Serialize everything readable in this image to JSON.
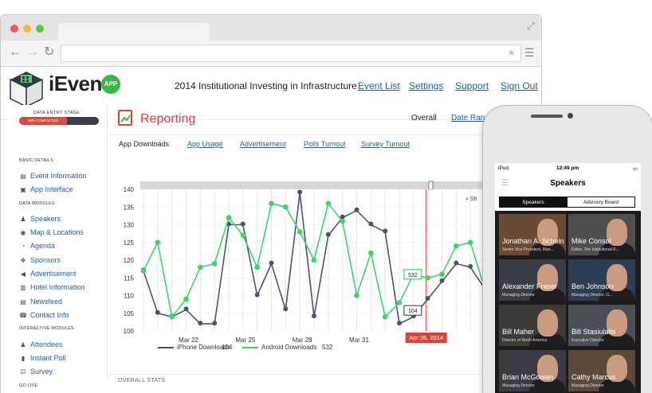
{
  "app": {
    "name": "iEvent",
    "badge": "APP"
  },
  "header": {
    "event_title": "2014 Institutional Investing in Infrastructure",
    "links": [
      "Event List",
      "Settings",
      "Support",
      "Sign Out"
    ]
  },
  "sidebar": {
    "stage_label": "DATA ENTRY STAGE",
    "stage_progress_text": "10% COMPLETED",
    "stage_progress": 0.6,
    "sections": [
      {
        "title": "BASIC DETAILS",
        "items": [
          {
            "label": "Event Information",
            "icon": "info-icon"
          },
          {
            "label": "App Interface",
            "icon": "app-icon"
          }
        ]
      },
      {
        "title": "DATA MODULES",
        "items": [
          {
            "label": "Speakers",
            "icon": "person-icon"
          },
          {
            "label": "Map & Locations",
            "icon": "location-icon"
          },
          {
            "label": "Agenda",
            "icon": "agenda-icon"
          },
          {
            "label": "Sponsors",
            "icon": "sponsors-icon"
          },
          {
            "label": "Advertisement",
            "icon": "megaphone-icon"
          },
          {
            "label": "Hotel Information",
            "icon": "hotel-icon"
          },
          {
            "label": "Newsfeed",
            "icon": "newsfeed-icon"
          },
          {
            "label": "Contact Info",
            "icon": "contact-icon"
          }
        ]
      },
      {
        "title": "INTERACTIVE MODULES",
        "items": [
          {
            "label": "Attendees",
            "icon": "attendees-icon"
          },
          {
            "label": "Instant Poll",
            "icon": "poll-icon"
          },
          {
            "label": "Survey",
            "icon": "survey-icon"
          }
        ]
      },
      {
        "title": "GO LIVE",
        "items": []
      }
    ]
  },
  "main": {
    "title": "Reporting",
    "view_tabs": [
      "Overall",
      "Date Range"
    ],
    "report_tabs": [
      "App Downloads",
      "App Usage",
      "Advertisement",
      "Polls Turnout",
      "Survey Turnout"
    ],
    "footer_label": "OVERALL STATS",
    "legend": [
      {
        "name": "iPhone Downloads",
        "value": "104",
        "color": "#4a5569"
      },
      {
        "name": "Android Downloads",
        "value": "532",
        "color": "#3fd36a"
      }
    ],
    "tooltip_date": "Apr 06, 2014",
    "tooltip_values": {
      "android": "532",
      "iphone": "104"
    },
    "zoom_label": "Sh"
  },
  "chart_data": {
    "type": "line",
    "x_tick_labels": [
      "Mar 22",
      "Mar 25",
      "Mar 28",
      "Mar 31",
      "Apr"
    ],
    "y_ticks": [
      100,
      105,
      110,
      115,
      120,
      125,
      130,
      135,
      140
    ],
    "ylim": [
      100,
      140
    ],
    "series": [
      {
        "name": "iPhone Downloads",
        "color": "#4a5569",
        "values": [
          117,
          105,
          104,
          106,
          102,
          102,
          130,
          130,
          110,
          119,
          106,
          139,
          104,
          127,
          132,
          134,
          130,
          128,
          102,
          104,
          109,
          114,
          119,
          118,
          112
        ]
      },
      {
        "name": "Android Downloads",
        "color": "#3fd36a",
        "values": [
          117,
          125,
          104,
          109,
          118,
          119,
          132,
          127,
          118,
          136,
          135,
          128,
          120,
          136,
          131,
          110,
          122,
          104,
          108,
          116,
          115,
          116,
          124,
          125,
          112
        ]
      }
    ]
  },
  "phone": {
    "status_left": "iPod",
    "status_time": "12:49 pm",
    "nav_title": "Speakers",
    "segments": [
      "Speakers",
      "Advisory Board"
    ],
    "speakers": [
      {
        "name": "Jonathan A. Schein",
        "role": "Senior Vice President, Man..."
      },
      {
        "name": "Mike Consol",
        "role": "Editor, The Institutional R..."
      },
      {
        "name": "Alexander Fraser",
        "role": "Managing Director"
      },
      {
        "name": "Ben Johnson",
        "role": "Managing Director, G..."
      },
      {
        "name": "Bill Maher",
        "role": "Director of North America"
      },
      {
        "name": "Bill Stasiulatis",
        "role": "Executive Director"
      },
      {
        "name": "Brian McGowan",
        "role": "Managing Director"
      },
      {
        "name": "Cathy Marcus",
        "role": "Managing Director"
      }
    ]
  }
}
